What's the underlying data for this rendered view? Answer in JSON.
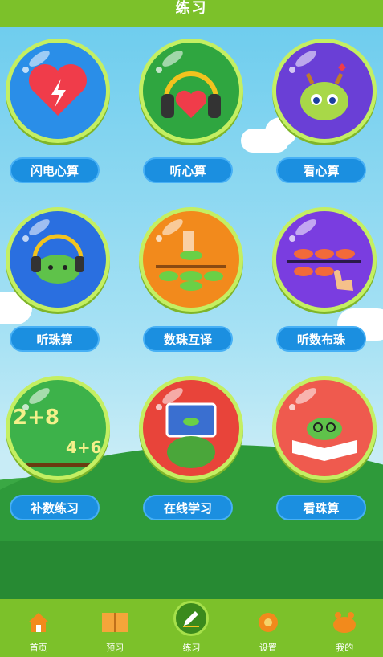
{
  "header": {
    "title": "练习"
  },
  "modules": [
    {
      "label": "闪电心算",
      "icon": "lightning-heart-icon",
      "bg": "#2a8ee8"
    },
    {
      "label": "听心算",
      "icon": "headphones-heart-icon",
      "bg": "#2fa640"
    },
    {
      "label": "看心算",
      "icon": "dragon-icon",
      "bg": "#6a3fd6"
    },
    {
      "label": "听珠算",
      "icon": "dragon-headphones-icon",
      "bg": "#2a6fe0"
    },
    {
      "label": "数珠互译",
      "icon": "abacus-numbers-icon",
      "bg": "#f28a1c"
    },
    {
      "label": "听数布珠",
      "icon": "abacus-hand-icon",
      "bg": "#7a3de0"
    },
    {
      "label": "补数练习",
      "icon": "equation-icon",
      "bg": "#3db24a"
    },
    {
      "label": "在线学习",
      "icon": "online-abacus-icon",
      "bg": "#e8443a"
    },
    {
      "label": "看珠算",
      "icon": "book-dragon-icon",
      "bg": "#ef5a4e"
    }
  ],
  "equation_text": {
    "top": "2+8",
    "bottom": "4+6"
  },
  "tabs": [
    {
      "label": "首页",
      "icon": "home-icon",
      "active": false
    },
    {
      "label": "预习",
      "icon": "book-icon",
      "active": false
    },
    {
      "label": "练习",
      "icon": "pencil-icon",
      "active": true
    },
    {
      "label": "设置",
      "icon": "gear-icon",
      "active": false
    },
    {
      "label": "我的",
      "icon": "crown-icon",
      "active": false
    }
  ],
  "colors": {
    "accent": "#7cc12a",
    "button": "#1b8fe0",
    "ring": "#c4ef62"
  }
}
